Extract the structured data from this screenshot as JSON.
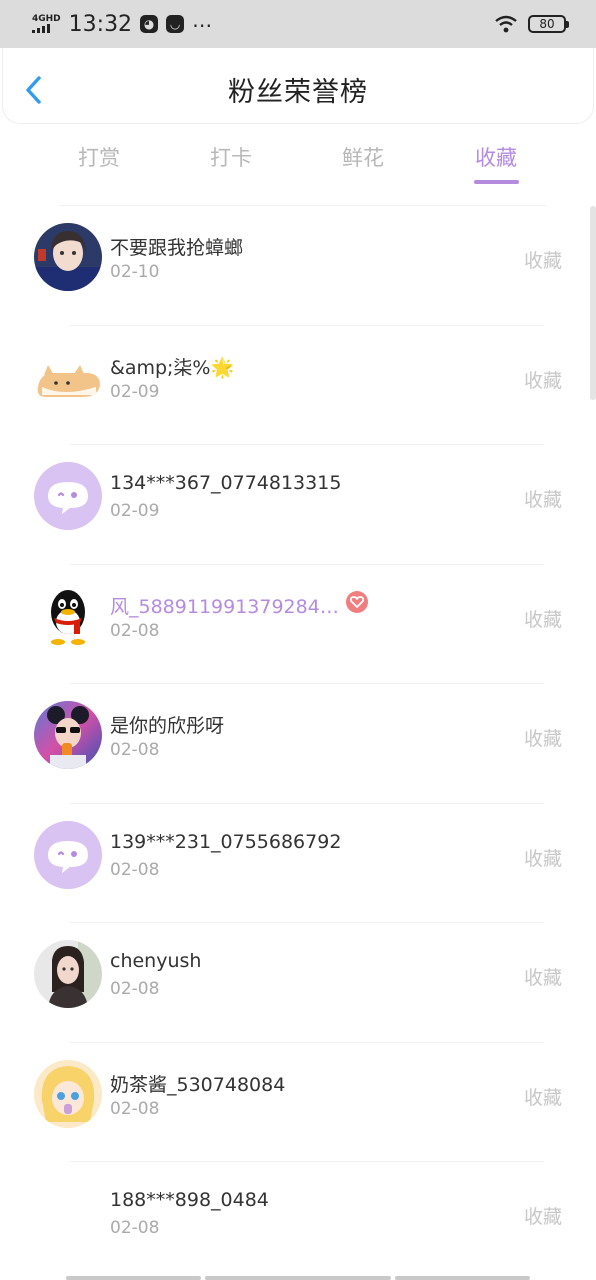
{
  "status_bar": {
    "network": "4GHD",
    "time": "13:32",
    "battery": "80"
  },
  "header": {
    "title": "粉丝荣誉榜"
  },
  "tabs": [
    {
      "label": "打赏"
    },
    {
      "label": "打卡"
    },
    {
      "label": "鲜花"
    },
    {
      "label": "收藏"
    }
  ],
  "active_tab": "收藏",
  "list": [
    {
      "name": "不要跟我抢蟑螂",
      "date": "02-10",
      "action": "收藏"
    },
    {
      "name": "&amp;柒%🌟",
      "date": "02-09",
      "action": "收藏"
    },
    {
      "name": "134***367_0774813315",
      "date": "02-09",
      "action": "收藏"
    },
    {
      "name": "风_588911991379284…",
      "date": "02-08",
      "action": "收藏"
    },
    {
      "name": "是你的欣彤呀",
      "date": "02-08",
      "action": "收藏"
    },
    {
      "name": "139***231_0755686792",
      "date": "02-08",
      "action": "收藏"
    },
    {
      "name": "chenyush",
      "date": "02-08",
      "action": "收藏"
    },
    {
      "name": "奶茶酱_530748084",
      "date": "02-08",
      "action": "收藏"
    },
    {
      "name": "188***898_0484",
      "date": "02-08",
      "action": "收藏"
    }
  ],
  "colors": {
    "accent": "#b58be0",
    "back_arrow": "#2f9cf0",
    "vip_badge": "#f07e7e",
    "muted_text": "#c8c8c8"
  }
}
